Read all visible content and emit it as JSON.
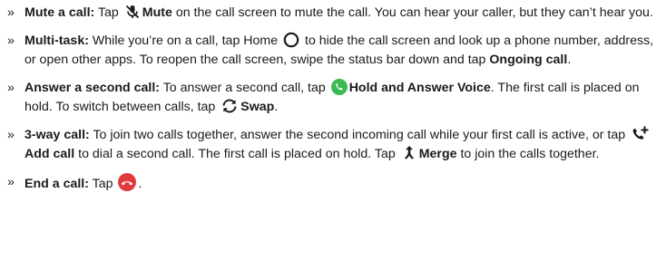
{
  "bullet": "»",
  "items": [
    {
      "term": "Mute a call:",
      "t1": " Tap ",
      "icon": "mic-off-icon",
      "b1": "Mute",
      "t2": " on the call screen to mute the call. You can hear your caller, but they can’t hear you."
    },
    {
      "term": "Multi-task:",
      "t1": " While you’re on a call, tap Home ",
      "icon": "home-circle-icon",
      "t2": " to hide the call screen and look up a phone number, address, or open other apps. To reopen the call screen, swipe the status bar down and tap ",
      "b1": "Ongoing call",
      "t3": "."
    },
    {
      "term": "Answer a second call:",
      "t1": " To answer a second call, tap ",
      "icon1": "answer-phone-icon",
      "b1": "Hold and Answer Voice",
      "t2": ". The first call is placed on hold. To switch between calls, tap ",
      "icon2": "swap-icon",
      "b2": "Swap",
      "t3": "."
    },
    {
      "term": "3-way call:",
      "t1": " To join two calls together, answer the second incoming call while your first call is active, or tap ",
      "icon1": "add-call-icon",
      "b1": "Add call",
      "t2": " to dial a second call. The first call is placed on hold. Tap ",
      "icon2": "merge-icon",
      "b2": "Merge",
      "t3": " to join the calls together."
    },
    {
      "term": "End a call:",
      "t1": " Tap ",
      "icon": "end-call-icon",
      "t2": "."
    }
  ],
  "colors": {
    "text": "#1a1a1a",
    "answer_green": "#3cba54",
    "end_red": "#e0393e"
  }
}
